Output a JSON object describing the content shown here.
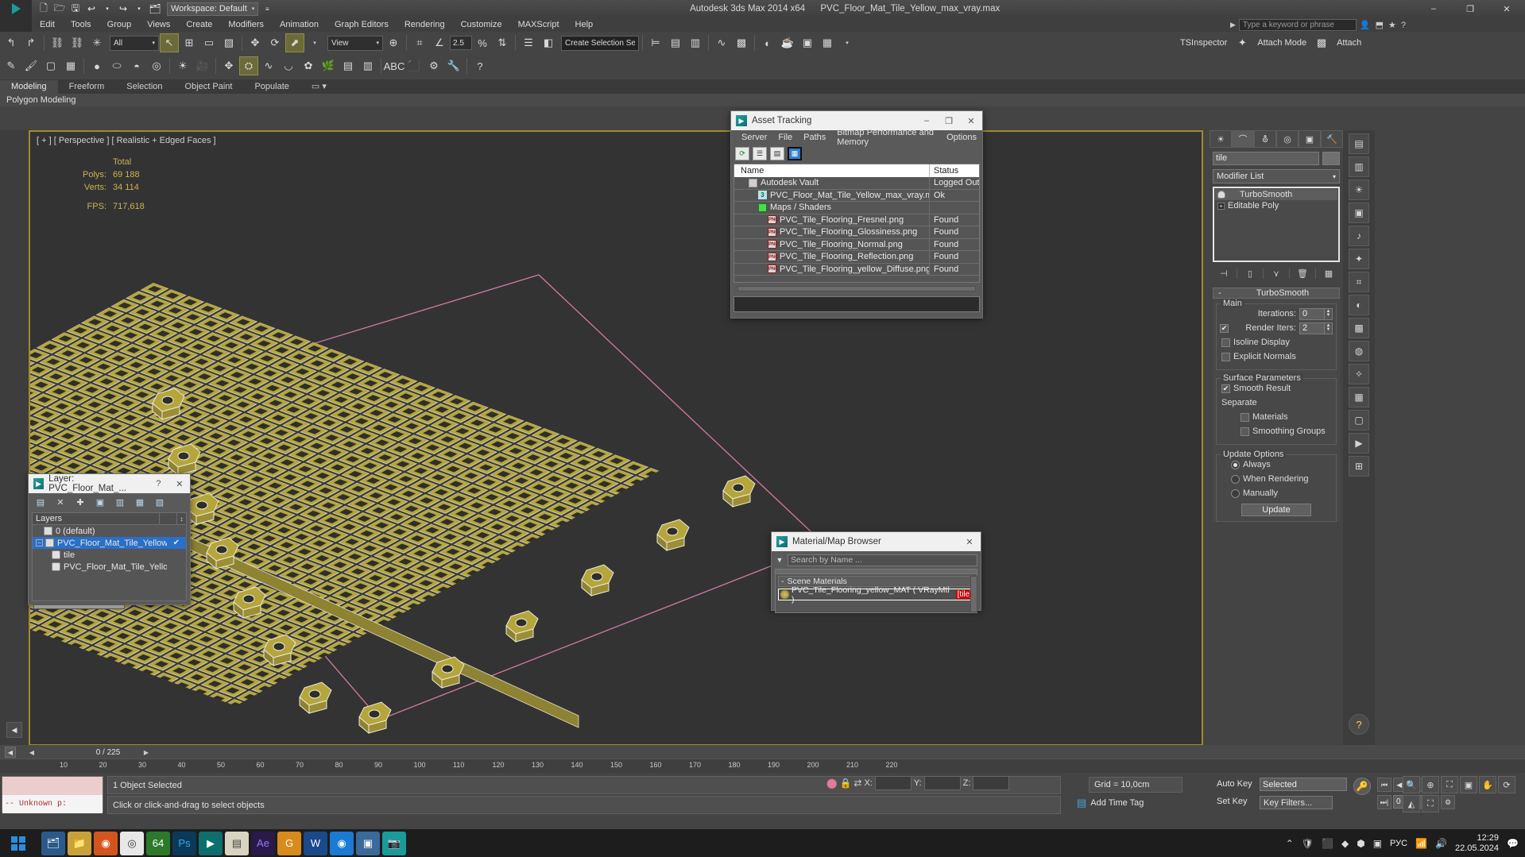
{
  "window": {
    "app_title": "Autodesk 3ds Max  2014 x64",
    "file_title": "PVC_Floor_Mat_Tile_Yellow_max_vray.max",
    "workspace": "Workspace: Default",
    "minimize": "–",
    "maximize": "❐",
    "close": "✕"
  },
  "menu": {
    "items": [
      "Edit",
      "Tools",
      "Group",
      "Views",
      "Create",
      "Modifiers",
      "Animation",
      "Graph Editors",
      "Rendering",
      "Customize",
      "MAXScript",
      "Help"
    ],
    "search_placeholder": "Type a keyword or phrase"
  },
  "toolbar": {
    "selection_filter": "All",
    "reference_coord": "View",
    "angle_snap_value": "2.5",
    "named_selection": "Create Selection Se",
    "tsinspector": "TSInspector",
    "attach_mode": "Attach Mode",
    "attach": "Attach"
  },
  "ribbon": {
    "tabs": [
      "Modeling",
      "Freeform",
      "Selection",
      "Object Paint",
      "Populate"
    ],
    "active_tab": "Modeling",
    "subtitle": "Polygon Modeling"
  },
  "viewport": {
    "label": "[ + ] [ Perspective ] [ Realistic + Edged Faces ]",
    "stats_header": "Total",
    "stats": [
      {
        "label": "Polys:",
        "value": "69 188"
      },
      {
        "label": "Verts:",
        "value": "34 114"
      },
      {
        "label": "FPS:",
        "value": "717,618"
      }
    ]
  },
  "asset_tracking": {
    "title": "Asset Tracking",
    "menu": [
      "Server",
      "File",
      "Paths",
      "Bitmap Performance and Memory",
      "Options"
    ],
    "toolbar_icons": [
      "refresh-icon",
      "list-icon",
      "paths-icon",
      "grid-icon"
    ],
    "columns": [
      "Name",
      "Status"
    ],
    "rows": [
      {
        "icon": "vault-icon",
        "indent": 1,
        "name": "Autodesk Vault",
        "status": "Logged Out"
      },
      {
        "icon": "max-file-icon",
        "indent": 2,
        "name": "PVC_Floor_Mat_Tile_Yellow_max_vray.max",
        "status": "Ok"
      },
      {
        "icon": "maps-shaders-icon",
        "indent": 2,
        "name": "Maps / Shaders",
        "status": ""
      },
      {
        "icon": "png-icon",
        "indent": 3,
        "name": "PVC_Tile_Flooring_Fresnel.png",
        "status": "Found"
      },
      {
        "icon": "png-icon",
        "indent": 3,
        "name": "PVC_Tile_Flooring_Glossiness.png",
        "status": "Found"
      },
      {
        "icon": "png-icon",
        "indent": 3,
        "name": "PVC_Tile_Flooring_Normal.png",
        "status": "Found"
      },
      {
        "icon": "png-icon",
        "indent": 3,
        "name": "PVC_Tile_Flooring_Reflection.png",
        "status": "Found"
      },
      {
        "icon": "png-icon",
        "indent": 3,
        "name": "PVC_Tile_Flooring_yellow_Diffuse.png",
        "status": "Found"
      }
    ]
  },
  "layer_dialog": {
    "title": "Layer: PVC_Floor_Mat_...",
    "help": "?",
    "close": "✕",
    "column_header": "Layers",
    "rows": [
      {
        "icon": "layer-icon",
        "name": "0 (default)",
        "selected": false,
        "expandable": false,
        "indent": 1,
        "check": ""
      },
      {
        "icon": "layer-icon",
        "name": "PVC_Floor_Mat_Tile_Yellow",
        "selected": true,
        "expandable": true,
        "indent": 0,
        "check": "✔"
      },
      {
        "icon": "object-icon",
        "name": "tile",
        "selected": false,
        "expandable": false,
        "indent": 2,
        "check": ""
      },
      {
        "icon": "object-icon",
        "name": "PVC_Floor_Mat_Tile_Yellow",
        "selected": false,
        "expandable": false,
        "indent": 2,
        "check": ""
      }
    ]
  },
  "material_browser": {
    "title": "Material/Map Browser",
    "close": "✕",
    "search_placeholder": "Search by Name ...",
    "group": "Scene Materials",
    "group_toggle": "-",
    "material_name": "PVC_Tile_Flooring_yellow_MAT  ( VRayMtl )",
    "material_tag": "[tile]"
  },
  "command_panel": {
    "tabs": [
      "create-tab",
      "modify-tab",
      "hierarchy-tab",
      "motion-tab",
      "display-tab",
      "utilities-tab"
    ],
    "active_tab": "modify-tab",
    "object_name": "tile",
    "modifier_list": "Modifier List",
    "stack": [
      {
        "name": "TurboSmooth",
        "selected": true,
        "icon": "bulb-icon"
      },
      {
        "name": "Editable Poly",
        "selected": false,
        "icon": "plus-icon"
      }
    ],
    "rollout": {
      "title": "TurboSmooth",
      "collapse": "-",
      "main_label": "Main",
      "iterations_label": "Iterations:",
      "iterations_value": "0",
      "render_iters_label": "Render Iters:",
      "render_iters_value": "2",
      "render_iters_checked": true,
      "isoline_label": "Isoline Display",
      "isoline_checked": false,
      "explicit_label": "Explicit Normals",
      "explicit_checked": false,
      "surface_label": "Surface Parameters",
      "smooth_result_label": "Smooth Result",
      "smooth_result_checked": true,
      "separate_label": "Separate",
      "materials_label": "Materials",
      "materials_checked": false,
      "smoothing_groups_label": "Smoothing Groups",
      "smoothing_groups_checked": false,
      "update_label": "Update Options",
      "radio_always": "Always",
      "radio_when_rendering": "When Rendering",
      "radio_manually": "Manually",
      "radio_selected": "Always",
      "update_button": "Update"
    }
  },
  "timeline": {
    "ticks": [
      "10",
      "20",
      "30",
      "40",
      "50",
      "60",
      "70",
      "80",
      "90",
      "100",
      "110",
      "120",
      "130",
      "140",
      "150",
      "160",
      "170",
      "180",
      "190",
      "200",
      "210",
      "220"
    ],
    "frame_display": "0 / 225"
  },
  "status_bar": {
    "selection": "1 Object Selected",
    "prompt": "Click or click-and-drag to select objects",
    "x_label": "X:",
    "y_label": "Y:",
    "z_label": "Z:",
    "x_value": "",
    "y_value": "",
    "z_value": "",
    "grid": "Grid = 10,0cm",
    "add_time_tag": "Add Time Tag",
    "mini_listener": "-- Unknown p:",
    "auto_key": "Auto Key",
    "set_key": "Set Key",
    "key_mode": "Selected",
    "key_filters": "Key Filters...",
    "current_frame": "0"
  },
  "taskbar": {
    "apps": [
      "explorer-icon",
      "folder-icon",
      "firefox-icon",
      "chrome-icon",
      "x64-icon",
      "photoshop-icon",
      "max-icon",
      "notes-icon",
      "ae-icon",
      "g-icon",
      "word-icon",
      "edge-icon",
      "media-icon",
      "camera-icon"
    ],
    "lang": "РУС",
    "time": "12:29",
    "date": "22.05.2024"
  },
  "colors": {
    "viewport_border": "#a08a30",
    "accent_blue": "#2a6fc9",
    "stat_text": "#c8b451",
    "tile_yellow": "#b8a93f",
    "selection_red": "#cc0000"
  }
}
